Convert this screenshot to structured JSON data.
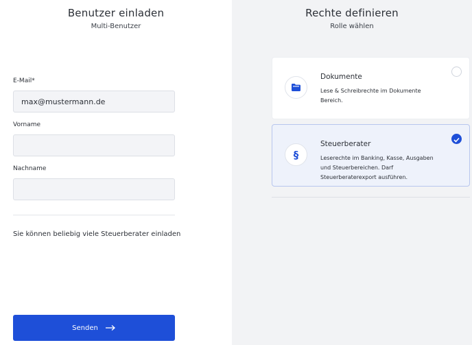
{
  "invite": {
    "title": "Benutzer einladen",
    "subtitle": "Multi-Benutzer",
    "email_label": "E-Mail*",
    "email_value": "max@mustermann.de",
    "firstname_label": "Vorname",
    "firstname_value": "",
    "lastname_label": "Nachname",
    "lastname_value": "",
    "info_text": "Sie können beliebig viele Steuerberater einladen",
    "send_label": "Senden"
  },
  "rights": {
    "title": "Rechte definieren",
    "subtitle": "Rolle wählen",
    "roles": [
      {
        "title": "Dokumente",
        "description": "Lese & Schreibrechte im Dokumente Bereich.",
        "icon": "folder-icon",
        "selected": false
      },
      {
        "title": "Steuerberater",
        "description": "Leserechte im Banking, Kasse, Ausgaben und Steuerbereichen. Darf Steuerberaterexport ausführen.",
        "icon": "paragraph-icon",
        "glyph": "§",
        "selected": true
      }
    ]
  },
  "colors": {
    "accent": "#1e4fd8",
    "panel_background": "#f2f3f5",
    "input_background": "#f3f4f7"
  }
}
